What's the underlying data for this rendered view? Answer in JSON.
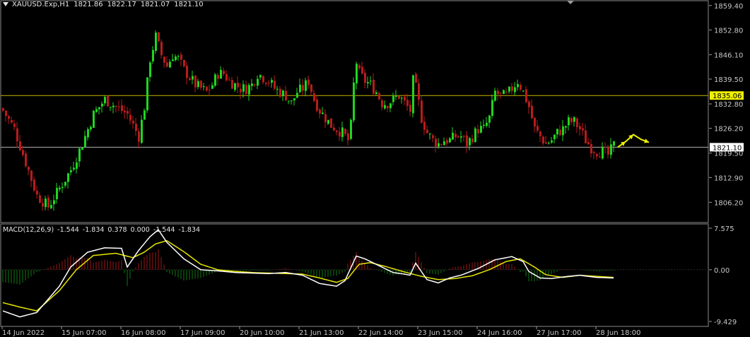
{
  "header": {
    "symbol": "XAUUSD.Exp,H1",
    "open": "1821.86",
    "high": "1822.17",
    "low": "1821.07",
    "close": "1821.10"
  },
  "macd_header": {
    "label": "MACD(12,26,9)",
    "values": [
      "-1.544",
      "-1.834",
      "0.378",
      "0.000",
      "-1.544",
      "-1.834"
    ]
  },
  "colors": {
    "bull": "#1fd61f",
    "bear": "#b81c1c",
    "signal_line": "#e6e600",
    "macd_line": "#ffffff",
    "hline": "#c8b400",
    "price_tag": "#f0f000",
    "grid": "#2a2a2a"
  },
  "chart_data": [
    {
      "type": "candlestick",
      "title": "XAUUSD.Exp,H1",
      "ylim": [
        1801.5,
        1860.5
      ],
      "y_ticks": [
        "1859.40",
        "1852.80",
        "1846.10",
        "1839.50",
        "1832.80",
        "1826.20",
        "1819.50",
        "1812.90",
        "1806.20"
      ],
      "horizontal_levels": [
        1835.06,
        1821.1
      ],
      "price_labels": [
        "1835.06",
        "1821.10"
      ],
      "x_tick_labels": [
        "14 Jun 2022",
        "15 Jun 07:00",
        "16 Jun 08:00",
        "17 Jun 09:00",
        "20 Jun 10:00",
        "21 Jun 13:00",
        "22 Jun 14:00",
        "23 Jun 15:00",
        "24 Jun 16:00",
        "27 Jun 17:00",
        "28 Jun 18:00"
      ],
      "close_anchors": [
        [
          0,
          1831.0
        ],
        [
          4,
          1826.0
        ],
        [
          8,
          1817.0
        ],
        [
          12,
          1808.0
        ],
        [
          16,
          1805.0
        ],
        [
          20,
          1810.0
        ],
        [
          24,
          1815.0
        ],
        [
          28,
          1822.0
        ],
        [
          32,
          1830.0
        ],
        [
          36,
          1834.0
        ],
        [
          40,
          1832.0
        ],
        [
          44,
          1830.0
        ],
        [
          48,
          1824.0
        ],
        [
          50,
          1832.0
        ],
        [
          52,
          1845.0
        ],
        [
          54,
          1851.0
        ],
        [
          56,
          1846.0
        ],
        [
          58,
          1843.0
        ],
        [
          60,
          1846.0
        ],
        [
          62,
          1845.0
        ],
        [
          64,
          1842.0
        ],
        [
          66,
          1840.0
        ],
        [
          68,
          1838.0
        ],
        [
          70,
          1837.0
        ],
        [
          72,
          1836.0
        ],
        [
          74,
          1838.0
        ],
        [
          76,
          1841.0
        ],
        [
          78,
          1841.0
        ],
        [
          80,
          1839.0
        ],
        [
          82,
          1838.0
        ],
        [
          84,
          1837.0
        ],
        [
          86,
          1837.0
        ],
        [
          88,
          1838.0
        ],
        [
          90,
          1841.0
        ],
        [
          92,
          1840.0
        ],
        [
          94,
          1839.0
        ],
        [
          96,
          1837.0
        ],
        [
          98,
          1836.0
        ],
        [
          100,
          1835.0
        ],
        [
          102,
          1833.0
        ],
        [
          104,
          1836.0
        ],
        [
          106,
          1837.0
        ],
        [
          108,
          1839.0
        ],
        [
          110,
          1834.0
        ],
        [
          112,
          1831.0
        ],
        [
          114,
          1829.0
        ],
        [
          116,
          1827.0
        ],
        [
          118,
          1826.0
        ],
        [
          120,
          1825.0
        ],
        [
          122,
          1823.0
        ],
        [
          123,
          1827.0
        ],
        [
          124,
          1838.0
        ],
        [
          125,
          1844.0
        ],
        [
          126,
          1841.0
        ],
        [
          128,
          1839.0
        ],
        [
          130,
          1838.0
        ],
        [
          132,
          1836.0
        ],
        [
          134,
          1833.0
        ],
        [
          136,
          1833.0
        ],
        [
          138,
          1834.0
        ],
        [
          140,
          1835.0
        ],
        [
          142,
          1833.0
        ],
        [
          144,
          1831.0
        ],
        [
          145,
          1839.0
        ],
        [
          146,
          1837.0
        ],
        [
          148,
          1829.0
        ],
        [
          150,
          1825.0
        ],
        [
          152,
          1823.0
        ],
        [
          154,
          1822.0
        ],
        [
          156,
          1823.0
        ],
        [
          158,
          1823.0
        ],
        [
          160,
          1824.0
        ],
        [
          162,
          1824.0
        ],
        [
          164,
          1822.0
        ],
        [
          166,
          1824.0
        ],
        [
          168,
          1826.0
        ],
        [
          170,
          1826.0
        ],
        [
          172,
          1829.0
        ],
        [
          174,
          1836.0
        ],
        [
          176,
          1835.0
        ],
        [
          178,
          1835.0
        ],
        [
          180,
          1837.0
        ],
        [
          182,
          1839.0
        ],
        [
          184,
          1836.0
        ],
        [
          186,
          1832.0
        ],
        [
          188,
          1826.0
        ],
        [
          190,
          1824.0
        ],
        [
          192,
          1822.0
        ],
        [
          194,
          1823.0
        ],
        [
          196,
          1825.0
        ],
        [
          198,
          1826.0
        ],
        [
          200,
          1828.0
        ],
        [
          202,
          1828.0
        ],
        [
          204,
          1826.0
        ],
        [
          206,
          1823.0
        ],
        [
          208,
          1821.0
        ],
        [
          210,
          1820.0
        ],
        [
          212,
          1820.0
        ],
        [
          214,
          1819.0
        ],
        [
          216,
          1821.6
        ]
      ],
      "projection_path": [
        [
          1821.1,
          1823.5
        ],
        [
          1822.6,
          1820.5
        ],
        [
          1824.5,
          1823.3
        ],
        [
          1823.2,
          1824.8
        ],
        [
          1822.4,
          1826.0
        ]
      ]
    },
    {
      "type": "line",
      "title": "MACD(12,26,9)",
      "ylim": [
        -9.429,
        7.575
      ],
      "y_ticks": [
        "7.575",
        "0.00",
        "-9.429"
      ],
      "series": [
        {
          "name": "",
          "color": "white",
          "points": [
            [
              0,
              -7.5
            ],
            [
              6,
              -8.6
            ],
            [
              12,
              -7.8
            ],
            [
              20,
              -3.0
            ],
            [
              24,
              0.5
            ],
            [
              30,
              3.2
            ],
            [
              36,
              4.0
            ],
            [
              42,
              3.9
            ],
            [
              44,
              0.5
            ],
            [
              48,
              3.5
            ],
            [
              52,
              6.0
            ],
            [
              55,
              7.3
            ],
            [
              58,
              5.0
            ],
            [
              64,
              2.0
            ],
            [
              70,
              0.0
            ],
            [
              76,
              -0.2
            ],
            [
              82,
              -0.5
            ],
            [
              88,
              -0.6
            ],
            [
              94,
              -0.7
            ],
            [
              100,
              -0.5
            ],
            [
              106,
              -1.0
            ],
            [
              112,
              -2.5
            ],
            [
              118,
              -3.0
            ],
            [
              121,
              -2.0
            ],
            [
              125,
              2.5
            ],
            [
              128,
              2.0
            ],
            [
              134,
              0.5
            ],
            [
              138,
              -0.5
            ],
            [
              142,
              -0.8
            ],
            [
              144,
              -1.0
            ],
            [
              146,
              1.2
            ],
            [
              150,
              -1.8
            ],
            [
              154,
              -2.4
            ],
            [
              158,
              -1.5
            ],
            [
              162,
              -1.0
            ],
            [
              168,
              0.2
            ],
            [
              174,
              1.8
            ],
            [
              180,
              2.4
            ],
            [
              184,
              1.5
            ],
            [
              186,
              -0.3
            ],
            [
              190,
              -1.5
            ],
            [
              194,
              -1.6
            ],
            [
              200,
              -1.2
            ],
            [
              204,
              -1.0
            ],
            [
              210,
              -1.4
            ],
            [
              216,
              -1.5
            ]
          ]
        },
        {
          "name": "",
          "color": "yellow",
          "points": [
            [
              0,
              -6.0
            ],
            [
              6,
              -6.8
            ],
            [
              12,
              -7.5
            ],
            [
              20,
              -3.8
            ],
            [
              26,
              0.0
            ],
            [
              32,
              2.6
            ],
            [
              40,
              3.0
            ],
            [
              46,
              2.2
            ],
            [
              50,
              3.2
            ],
            [
              54,
              4.7
            ],
            [
              58,
              5.3
            ],
            [
              64,
              3.3
            ],
            [
              70,
              1.0
            ],
            [
              76,
              0.0
            ],
            [
              82,
              -0.3
            ],
            [
              88,
              -0.5
            ],
            [
              94,
              -0.6
            ],
            [
              100,
              -0.7
            ],
            [
              106,
              -0.8
            ],
            [
              112,
              -1.5
            ],
            [
              118,
              -2.3
            ],
            [
              122,
              -1.6
            ],
            [
              126,
              1.0
            ],
            [
              130,
              1.3
            ],
            [
              136,
              0.5
            ],
            [
              142,
              -0.4
            ],
            [
              148,
              -1.2
            ],
            [
              154,
              -1.8
            ],
            [
              160,
              -1.6
            ],
            [
              166,
              -1.1
            ],
            [
              172,
              0.0
            ],
            [
              178,
              1.5
            ],
            [
              183,
              2.0
            ],
            [
              188,
              0.5
            ],
            [
              192,
              -0.9
            ],
            [
              198,
              -1.4
            ],
            [
              204,
              -1.0
            ],
            [
              210,
              -1.2
            ],
            [
              216,
              -1.4
            ]
          ]
        }
      ]
    }
  ]
}
